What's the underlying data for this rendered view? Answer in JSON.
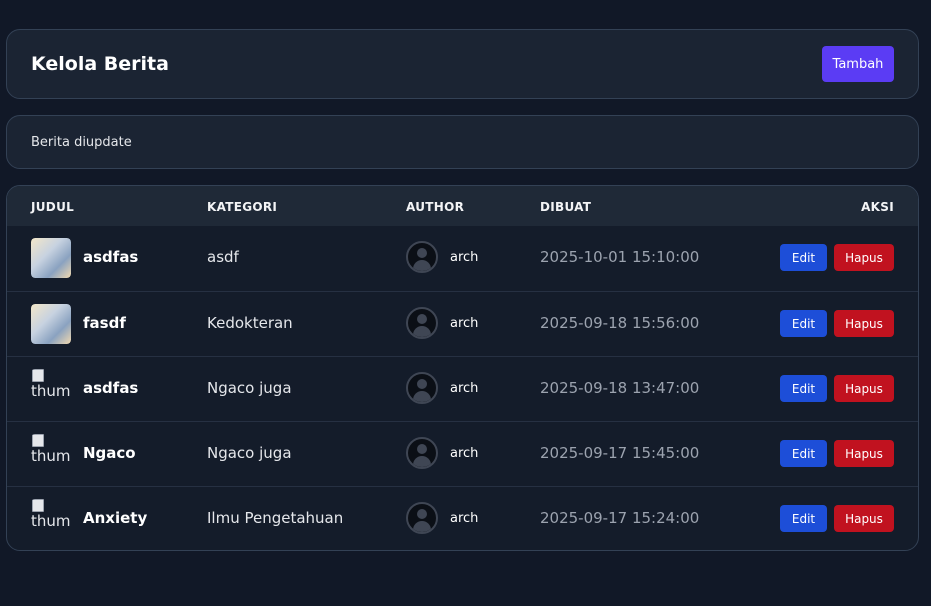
{
  "header": {
    "title": "Kelola Berita",
    "add_label": "Tambah"
  },
  "alert": {
    "message": "Berita diupdate"
  },
  "table": {
    "columns": [
      "JUDUL",
      "KATEGORI",
      "AUTHOR",
      "DIBUAT",
      "AKSI"
    ],
    "edit_label": "Edit",
    "delete_label": "Hapus",
    "broken_thumb_alt": "thumb",
    "rows": [
      {
        "title": "asdfas",
        "category": "asdf",
        "author": "arch",
        "created": "2025-10-01 15:10:00",
        "thumb": "image"
      },
      {
        "title": "fasdf",
        "category": "Kedokteran",
        "author": "arch",
        "created": "2025-09-18 15:56:00",
        "thumb": "image"
      },
      {
        "title": "asdfas",
        "category": "Ngaco juga",
        "author": "arch",
        "created": "2025-09-18 13:47:00",
        "thumb": "broken"
      },
      {
        "title": "Ngaco",
        "category": "Ngaco juga",
        "author": "arch",
        "created": "2025-09-17 15:45:00",
        "thumb": "broken"
      },
      {
        "title": "Anxiety",
        "category": "Ilmu Pengetahuan",
        "author": "arch",
        "created": "2025-09-17 15:24:00",
        "thumb": "broken"
      }
    ]
  }
}
